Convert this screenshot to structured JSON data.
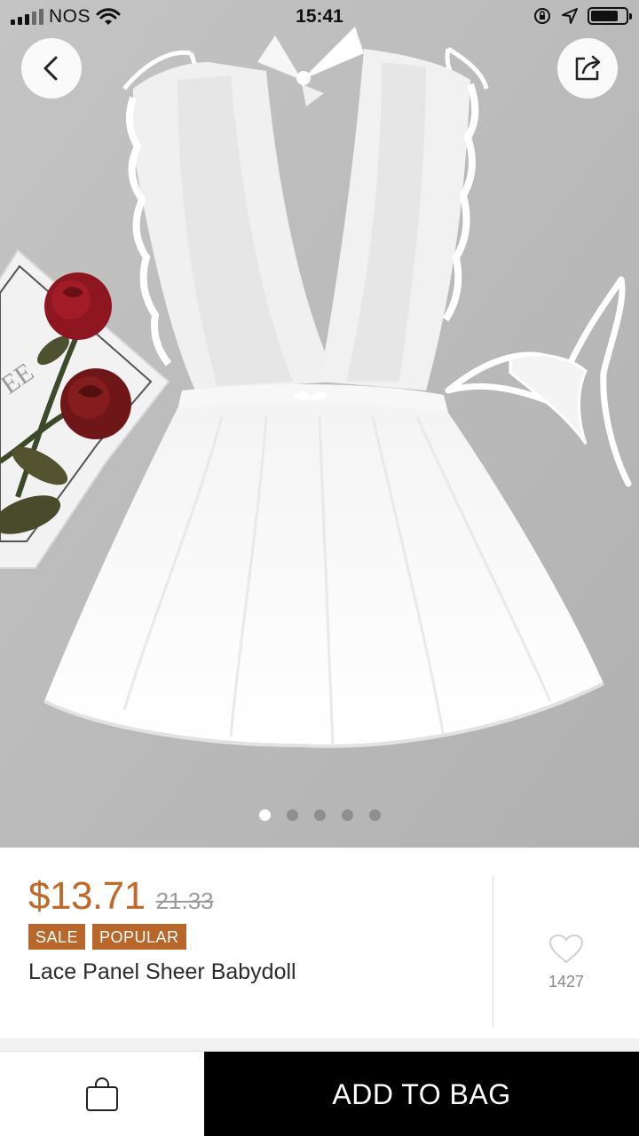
{
  "status_bar": {
    "carrier": "NOS",
    "time": "15:41",
    "icons": [
      "signal-icon",
      "wifi-icon",
      "orientation-lock-icon",
      "location-icon",
      "battery-icon"
    ]
  },
  "nav": {
    "back_icon": "chevron-left-icon",
    "share_icon": "share-icon"
  },
  "gallery": {
    "image_alt": "",
    "page_count": 5,
    "active_index": 0
  },
  "product": {
    "price": "$13.71",
    "original_price": "21.33",
    "badges": [
      "SALE",
      "POPULAR"
    ],
    "title": "Lace Panel Sheer Babydoll",
    "wishlist_count": "1427",
    "wishlist_icon": "heart-icon"
  },
  "actions": {
    "bag_icon": "shopping-bag-icon",
    "add_to_bag_label": "ADD TO BAG"
  },
  "colors": {
    "price": "#c0692a",
    "badge": "#b8662a",
    "primary_button": "#000000",
    "photo_background": "#b9b9b9"
  }
}
